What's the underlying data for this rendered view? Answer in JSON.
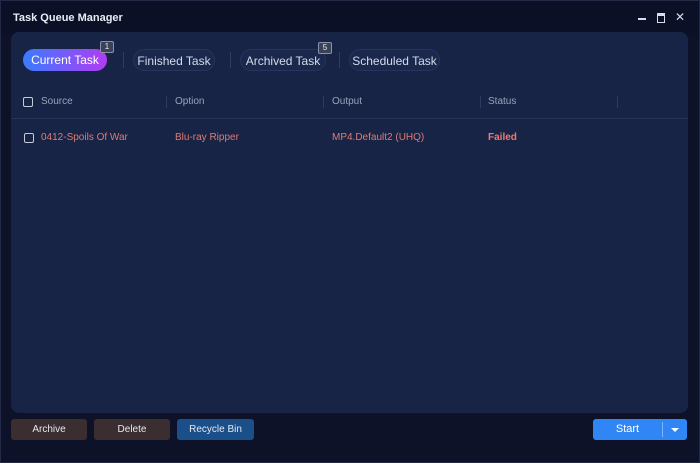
{
  "window": {
    "title": "Task Queue Manager"
  },
  "tabs": [
    {
      "label": "Current Task",
      "badge": "1",
      "active": true
    },
    {
      "label": "Finished Task",
      "badge": null,
      "active": false
    },
    {
      "label": "Archived Task",
      "badge": "5",
      "active": false
    },
    {
      "label": "Scheduled Task",
      "badge": null,
      "active": false
    }
  ],
  "table": {
    "columns": [
      "Source",
      "Option",
      "Output",
      "Status"
    ],
    "rows": [
      {
        "source": "0412-Spoils Of War",
        "option": "Blu-ray Ripper",
        "output": "MP4.Default2 (UHQ)",
        "status": "Failed"
      }
    ]
  },
  "footer": {
    "archive_label": "Archive",
    "delete_label": "Delete",
    "recycle_label": "Recycle Bin",
    "start_label": "Start"
  },
  "icons": {
    "minimize": "minimize-icon",
    "maximize": "maximize-icon",
    "close": "close-icon",
    "dropdown": "chevron-down-icon"
  },
  "colors": {
    "accent_start": "#2f86f4",
    "tab_gradient_from": "#3a7bff",
    "tab_gradient_to": "#b13cf2",
    "failed_text": "#f07970"
  }
}
